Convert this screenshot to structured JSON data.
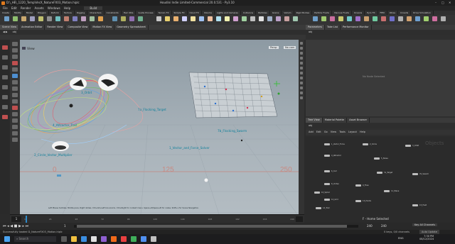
{
  "window": {
    "title_left": "D:\\_HE\\_1220_Temp\\VecX_NatureFX03_Motion.hiplc",
    "title_center": "Houdini Indie Limited-Commercial 20.0.531 - Py3.10"
  },
  "menu": [
    "File",
    "Edit",
    "Render",
    "Assets",
    "Windows",
    "Help"
  ],
  "desktop_label": "Build",
  "shelf_tabs": [
    "Create",
    "Modify",
    "Model",
    "Polygon",
    "Deform",
    "Texture",
    "Rigging",
    "Characters",
    "Constraints",
    "Hair Utils",
    "Guide Process",
    "Terrain FX",
    "Simple FX",
    "Cloud FX",
    "Volume",
    "Lights and Cameras",
    "Collisions",
    "Particles",
    "Grains",
    "Vellum",
    "Rigid Bodies",
    "Particle Fluids",
    "Viscous Fluids",
    "Oceans",
    "Pyro FX",
    "FEM",
    "Wires",
    "Crowds",
    "Drive Simulation"
  ],
  "pane_tabs_left": [
    "Scene View",
    "Animation Editor",
    "Render View",
    "Composite View",
    "Motion FX View",
    "Geometry Spreadsheet"
  ],
  "pane_tabs_right": [
    "Parameters",
    "Take List",
    "Performance Monitor"
  ],
  "path": "obj",
  "viewport": {
    "view_label": "View",
    "persp_label": "Persp",
    "cam_label": "No cam",
    "labels": {
      "attractor": "4_Attractor_Trail",
      "circle": "2_Circle_Vector_Multiplier",
      "flocking": "7b_Flocking_Swarm",
      "flock_target": "7a_Flocking_Target",
      "vector_force": "1_Vector_and_Force_Solver",
      "orbit": "3_Orbit"
    },
    "axis_numbers": [
      "0",
      "125",
      "250"
    ],
    "hint": "Left Mouse tumbles. Middle pans. Right dollies. Ctrl+Alt+Left box-zooms. Ctrl+Right for context menu. Space+Z/Space+B for nodes. Shift+L for Scene Navigation."
  },
  "params": {
    "empty_label": "No Node Selected"
  },
  "network": {
    "tabs": [
      "Tree View",
      "Material Palette",
      "Asset Browser"
    ],
    "path": "obj",
    "menu": [
      "Add",
      "Edit",
      "Go",
      "View",
      "Tools",
      "Layout",
      "Help"
    ],
    "watermark": "Objects",
    "nodes": [
      "1_Vector_Force",
      "2_Circle",
      "3_Orbit",
      "4_Attractor",
      "5_Noise",
      "6_Curl",
      "7a_Target",
      "7b_Swarm",
      "8_Vortex",
      "9_Flow",
      "10_Spiral",
      "11_Wave",
      "12_Grid",
      "13_Points",
      "14_Trail",
      "15_Field"
    ]
  },
  "timeline": {
    "frame": "1",
    "ticks": [
      "1",
      "24",
      "48",
      "72",
      "96",
      "120",
      "144",
      "168",
      "192",
      "216",
      "240"
    ],
    "start": "1",
    "end": "240",
    "end2": "240"
  },
  "status": {
    "message": "Successfully loaded D_NatureFX03_Motion.hiplc",
    "selection": "F - Home Selected",
    "auto_update": "Auto Update",
    "keys": "0 keys, 0/0 channels",
    "key_all": "Key All Channels"
  },
  "taskbar": {
    "search": "Search",
    "time": "7:30 PM",
    "date": "08/12/2024",
    "lang": "ENG"
  },
  "colors": {
    "accent": "#2d89c8",
    "label": "#0a7f9a",
    "axis": "#c88a82"
  }
}
